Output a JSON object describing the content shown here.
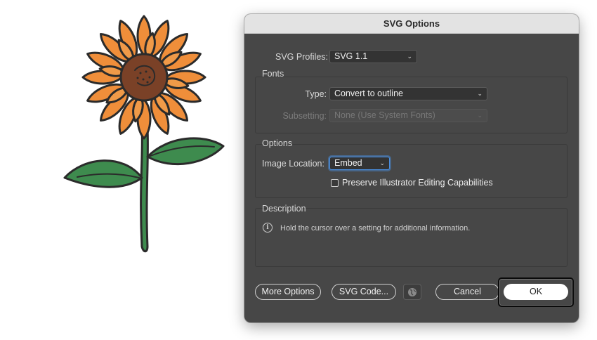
{
  "illustration": {
    "name": "sunflower"
  },
  "dialog": {
    "title": "SVG Options",
    "svg_profiles": {
      "label": "SVG Profiles:",
      "value": "SVG 1.1"
    },
    "fonts": {
      "group_label": "Fonts",
      "type_label": "Type:",
      "type_value": "Convert to outline",
      "subsetting_label": "Subsetting:",
      "subsetting_value": "None (Use System Fonts)"
    },
    "options": {
      "group_label": "Options",
      "image_location_label": "Image Location:",
      "image_location_value": "Embed",
      "preserve_label": "Preserve Illustrator Editing Capabilities",
      "preserve_checked": false
    },
    "description": {
      "group_label": "Description",
      "text": "Hold the cursor over a setting for additional information."
    },
    "buttons": {
      "more_options": "More Options",
      "svg_code": "SVG Code...",
      "cancel": "Cancel",
      "ok": "OK"
    }
  },
  "colors": {
    "dialog_bg": "#474747",
    "titlebar_bg": "#e3e3e3",
    "petal": "#ef8e3a",
    "center": "#7a4127",
    "leaf": "#3e8b4e"
  }
}
